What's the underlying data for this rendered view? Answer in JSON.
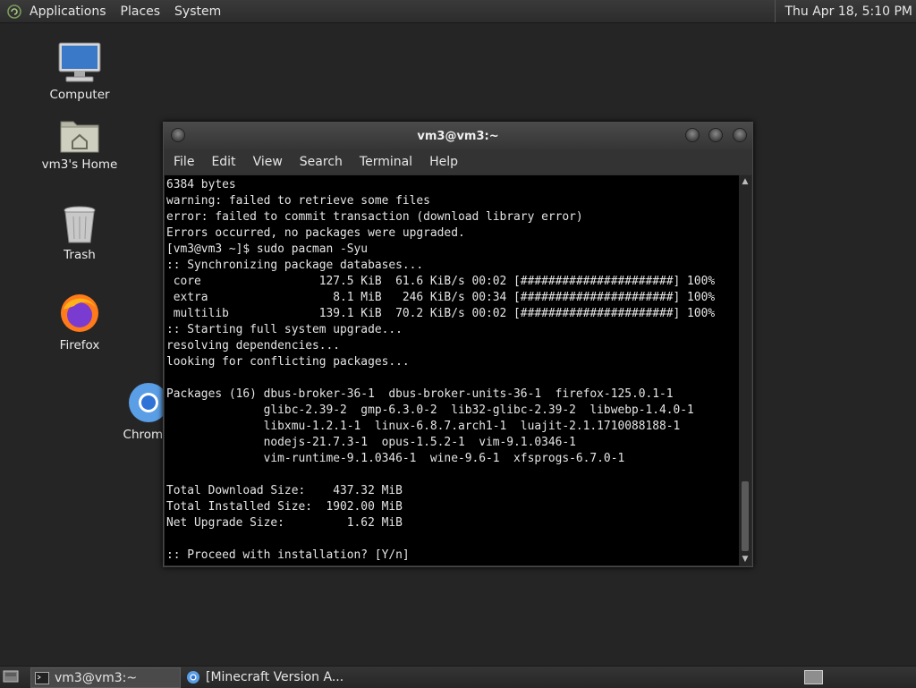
{
  "top_panel": {
    "menus": [
      "Applications",
      "Places",
      "System"
    ],
    "clock": "Thu Apr 18,  5:10 PM"
  },
  "desktop": {
    "icons": [
      {
        "label": "Computer",
        "icon": "computer-icon"
      },
      {
        "label": "vm3's Home",
        "icon": "home-folder-icon"
      },
      {
        "label": "Trash",
        "icon": "trash-icon"
      },
      {
        "label": "Firefox",
        "icon": "firefox-icon"
      },
      {
        "label": "Chromiu",
        "icon": "chromium-icon"
      }
    ]
  },
  "terminal": {
    "title": "vm3@vm3:~",
    "menu": [
      "File",
      "Edit",
      "View",
      "Search",
      "Terminal",
      "Help"
    ],
    "lines": [
      "6384 bytes",
      "warning: failed to retrieve some files",
      "error: failed to commit transaction (download library error)",
      "Errors occurred, no packages were upgraded.",
      "[vm3@vm3 ~]$ sudo pacman -Syu",
      ":: Synchronizing package databases...",
      " core                 127.5 KiB  61.6 KiB/s 00:02 [######################] 100%",
      " extra                  8.1 MiB   246 KiB/s 00:34 [######################] 100%",
      " multilib             139.1 KiB  70.2 KiB/s 00:02 [######################] 100%",
      ":: Starting full system upgrade...",
      "resolving dependencies...",
      "looking for conflicting packages...",
      "",
      "Packages (16) dbus-broker-36-1  dbus-broker-units-36-1  firefox-125.0.1-1",
      "              glibc-2.39-2  gmp-6.3.0-2  lib32-glibc-2.39-2  libwebp-1.4.0-1",
      "              libxmu-1.2.1-1  linux-6.8.7.arch1-1  luajit-2.1.1710088188-1",
      "              nodejs-21.7.3-1  opus-1.5.2-1  vim-9.1.0346-1",
      "              vim-runtime-9.1.0346-1  wine-9.6-1  xfsprogs-6.7.0-1",
      "",
      "Total Download Size:    437.32 MiB",
      "Total Installed Size:  1902.00 MiB",
      "Net Upgrade Size:         1.62 MiB",
      "",
      ":: Proceed with installation? [Y/n]"
    ]
  },
  "taskbar": {
    "tasks": [
      {
        "label": "vm3@vm3:~",
        "active": true
      },
      {
        "label": "[Minecraft Version A...",
        "active": false
      }
    ]
  }
}
